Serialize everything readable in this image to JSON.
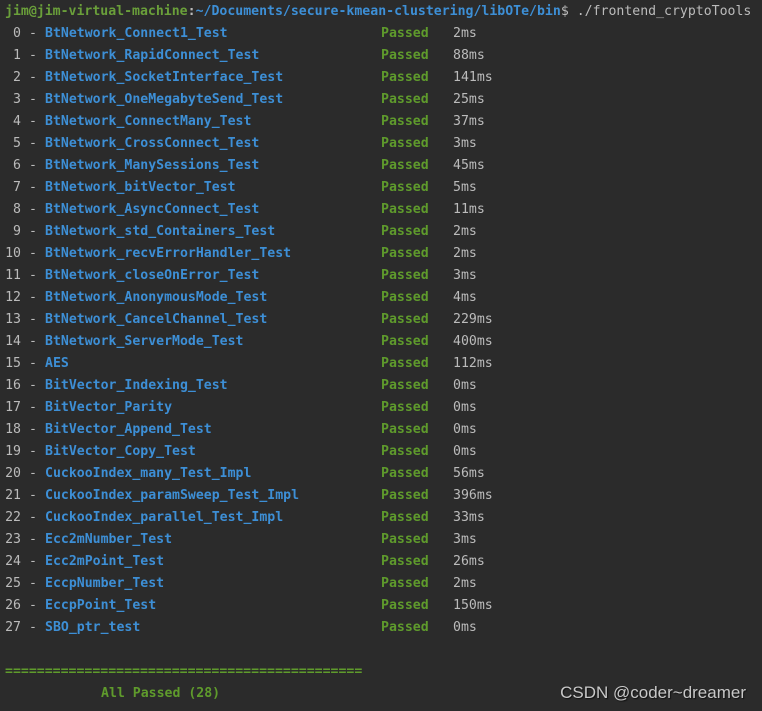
{
  "prompt": {
    "user_host": "jim@jim-virtual-machine",
    "colon": ":",
    "path": "~/Documents/secure-kmean-clustering/libOTe/bin",
    "dollar": "$",
    "command": " ./frontend_cryptoTools"
  },
  "tests": [
    {
      "index": "0",
      "name": "BtNetwork_Connect1_Test",
      "status": "Passed",
      "time": "2ms"
    },
    {
      "index": "1",
      "name": "BtNetwork_RapidConnect_Test",
      "status": "Passed",
      "time": "88ms"
    },
    {
      "index": "2",
      "name": "BtNetwork_SocketInterface_Test",
      "status": "Passed",
      "time": "141ms"
    },
    {
      "index": "3",
      "name": "BtNetwork_OneMegabyteSend_Test",
      "status": "Passed",
      "time": "25ms"
    },
    {
      "index": "4",
      "name": "BtNetwork_ConnectMany_Test",
      "status": "Passed",
      "time": "37ms"
    },
    {
      "index": "5",
      "name": "BtNetwork_CrossConnect_Test",
      "status": "Passed",
      "time": "3ms"
    },
    {
      "index": "6",
      "name": "BtNetwork_ManySessions_Test",
      "status": "Passed",
      "time": "45ms"
    },
    {
      "index": "7",
      "name": "BtNetwork_bitVector_Test",
      "status": "Passed",
      "time": "5ms"
    },
    {
      "index": "8",
      "name": "BtNetwork_AsyncConnect_Test",
      "status": "Passed",
      "time": "11ms"
    },
    {
      "index": "9",
      "name": "BtNetwork_std_Containers_Test",
      "status": "Passed",
      "time": "2ms"
    },
    {
      "index": "10",
      "name": "BtNetwork_recvErrorHandler_Test",
      "status": "Passed",
      "time": "2ms"
    },
    {
      "index": "11",
      "name": "BtNetwork_closeOnError_Test",
      "status": "Passed",
      "time": "3ms"
    },
    {
      "index": "12",
      "name": "BtNetwork_AnonymousMode_Test",
      "status": "Passed",
      "time": "4ms"
    },
    {
      "index": "13",
      "name": "BtNetwork_CancelChannel_Test",
      "status": "Passed",
      "time": "229ms"
    },
    {
      "index": "14",
      "name": "BtNetwork_ServerMode_Test",
      "status": "Passed",
      "time": "400ms"
    },
    {
      "index": "15",
      "name": "AES",
      "status": "Passed",
      "time": "112ms"
    },
    {
      "index": "16",
      "name": "BitVector_Indexing_Test",
      "status": "Passed",
      "time": "0ms"
    },
    {
      "index": "17",
      "name": "BitVector_Parity",
      "status": "Passed",
      "time": "0ms"
    },
    {
      "index": "18",
      "name": "BitVector_Append_Test",
      "status": "Passed",
      "time": "0ms"
    },
    {
      "index": "19",
      "name": "BitVector_Copy_Test",
      "status": "Passed",
      "time": "0ms"
    },
    {
      "index": "20",
      "name": "CuckooIndex_many_Test_Impl",
      "status": "Passed",
      "time": "56ms"
    },
    {
      "index": "21",
      "name": "CuckooIndex_paramSweep_Test_Impl",
      "status": "Passed",
      "time": "396ms"
    },
    {
      "index": "22",
      "name": "CuckooIndex_parallel_Test_Impl",
      "status": "Passed",
      "time": "33ms"
    },
    {
      "index": "23",
      "name": "Ecc2mNumber_Test",
      "status": "Passed",
      "time": "3ms"
    },
    {
      "index": "24",
      "name": "Ecc2mPoint_Test",
      "status": "Passed",
      "time": "26ms"
    },
    {
      "index": "25",
      "name": "EccpNumber_Test",
      "status": "Passed",
      "time": "2ms"
    },
    {
      "index": "26",
      "name": "EccpPoint_Test",
      "status": "Passed",
      "time": "150ms"
    },
    {
      "index": "27",
      "name": "SBO_ptr_test",
      "status": "Passed",
      "time": "0ms"
    }
  ],
  "dash": "-",
  "separator": "=============================================",
  "summary": "All Passed (28)",
  "watermark": "CSDN @coder~dreamer",
  "colors": {
    "background": "#2b2b2b",
    "user_host": "#6a9f3a",
    "path": "#3d8fd6",
    "test_name": "#3d8fd6",
    "passed": "#5f9b2c",
    "default_text": "#bbbbbb"
  }
}
